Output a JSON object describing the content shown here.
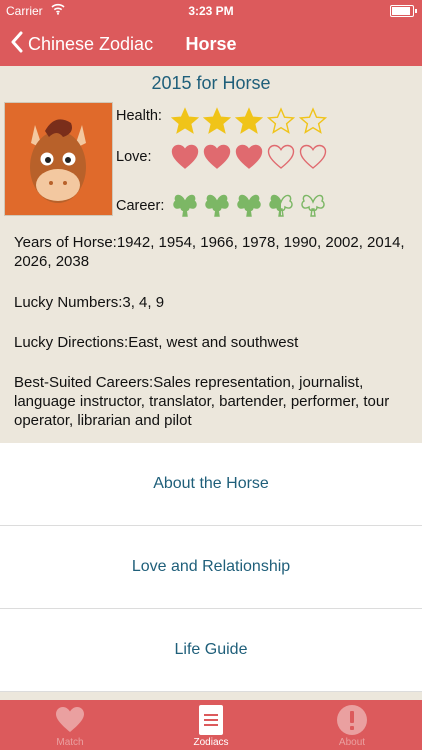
{
  "status_bar": {
    "carrier": "Carrier",
    "time": "3:23 PM",
    "battery_level": 0.9
  },
  "nav": {
    "back_label": "Chinese Zodiac",
    "title": "Horse"
  },
  "year_title": "2015 for Horse",
  "ratings": {
    "health": {
      "label": "Health:",
      "value": 3,
      "max": 5
    },
    "love": {
      "label": "Love:",
      "value": 3,
      "max": 5
    },
    "career": {
      "label": "Career:",
      "value": 3.5,
      "max": 5
    }
  },
  "info": {
    "years": "Years of Horse:1942, 1954, 1966, 1978, 1990, 2002, 2014, 2026, 2038",
    "lucky_numbers": "Lucky Numbers:3, 4, 9",
    "lucky_directions": "Lucky Directions:East, west and southwest",
    "careers": "Best-Suited Careers:Sales representation, journalist, language instructor, translator, bartender, performer, tour operator, librarian and pilot"
  },
  "menu": [
    {
      "label": "About the Horse"
    },
    {
      "label": "Love and Relationship"
    },
    {
      "label": "Life Guide"
    }
  ],
  "tabs": [
    {
      "label": "Match",
      "icon": "heart-icon"
    },
    {
      "label": "Zodiacs",
      "icon": "list-icon",
      "active": true
    },
    {
      "label": "About",
      "icon": "exclamation-icon"
    }
  ],
  "colors": {
    "accent": "#dc5a5c",
    "background": "#ece7dc",
    "link": "#1f5f7a",
    "star": "#f0c419",
    "heart": "#e06a6f",
    "clover": "#7cb765"
  }
}
